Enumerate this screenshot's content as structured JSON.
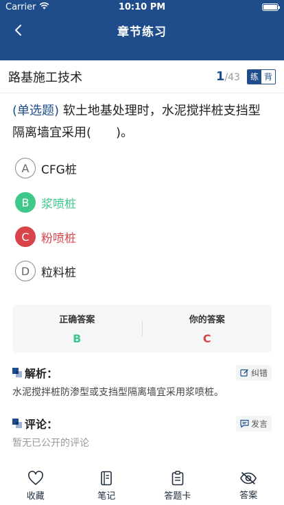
{
  "status_bar": {
    "carrier": "Carrier",
    "time": "10:10 PM"
  },
  "nav": {
    "title": "章节练习"
  },
  "chapter": {
    "title": "路基施工技术",
    "current": "1",
    "total": "/43",
    "mode_practice": "练",
    "mode_memorize": "背"
  },
  "question": {
    "type": "(单选题)",
    "text": " 软土地基处理时，水泥搅拌桩支挡型隔离墙宜采用(　　)。",
    "options": [
      {
        "letter": "A",
        "text": "CFG桩",
        "state": "normal"
      },
      {
        "letter": "B",
        "text": "浆喷桩",
        "state": "correct"
      },
      {
        "letter": "C",
        "text": "粉喷桩",
        "state": "wrong"
      },
      {
        "letter": "D",
        "text": "粒料桩",
        "state": "normal"
      }
    ]
  },
  "answer": {
    "correct_label": "正确答案",
    "correct_value": "B",
    "yours_label": "你的答案",
    "yours_value": "C"
  },
  "analysis": {
    "title": "解析：",
    "action": "纠错",
    "text": "水泥搅拌桩防渗型或支挡型隔离墙宜采用浆喷桩。"
  },
  "comments": {
    "title": "评论：",
    "action": "发言",
    "text": "暂无已公开的评论"
  },
  "tabbar": [
    {
      "label": "收藏",
      "icon": "heart-icon"
    },
    {
      "label": "笔记",
      "icon": "notebook-icon"
    },
    {
      "label": "答题卡",
      "icon": "answer-sheet-icon"
    },
    {
      "label": "答案",
      "icon": "eye-off-icon"
    }
  ],
  "colors": {
    "primary": "#1f4d8c",
    "correct": "#3fc88a",
    "wrong": "#d9444b"
  }
}
